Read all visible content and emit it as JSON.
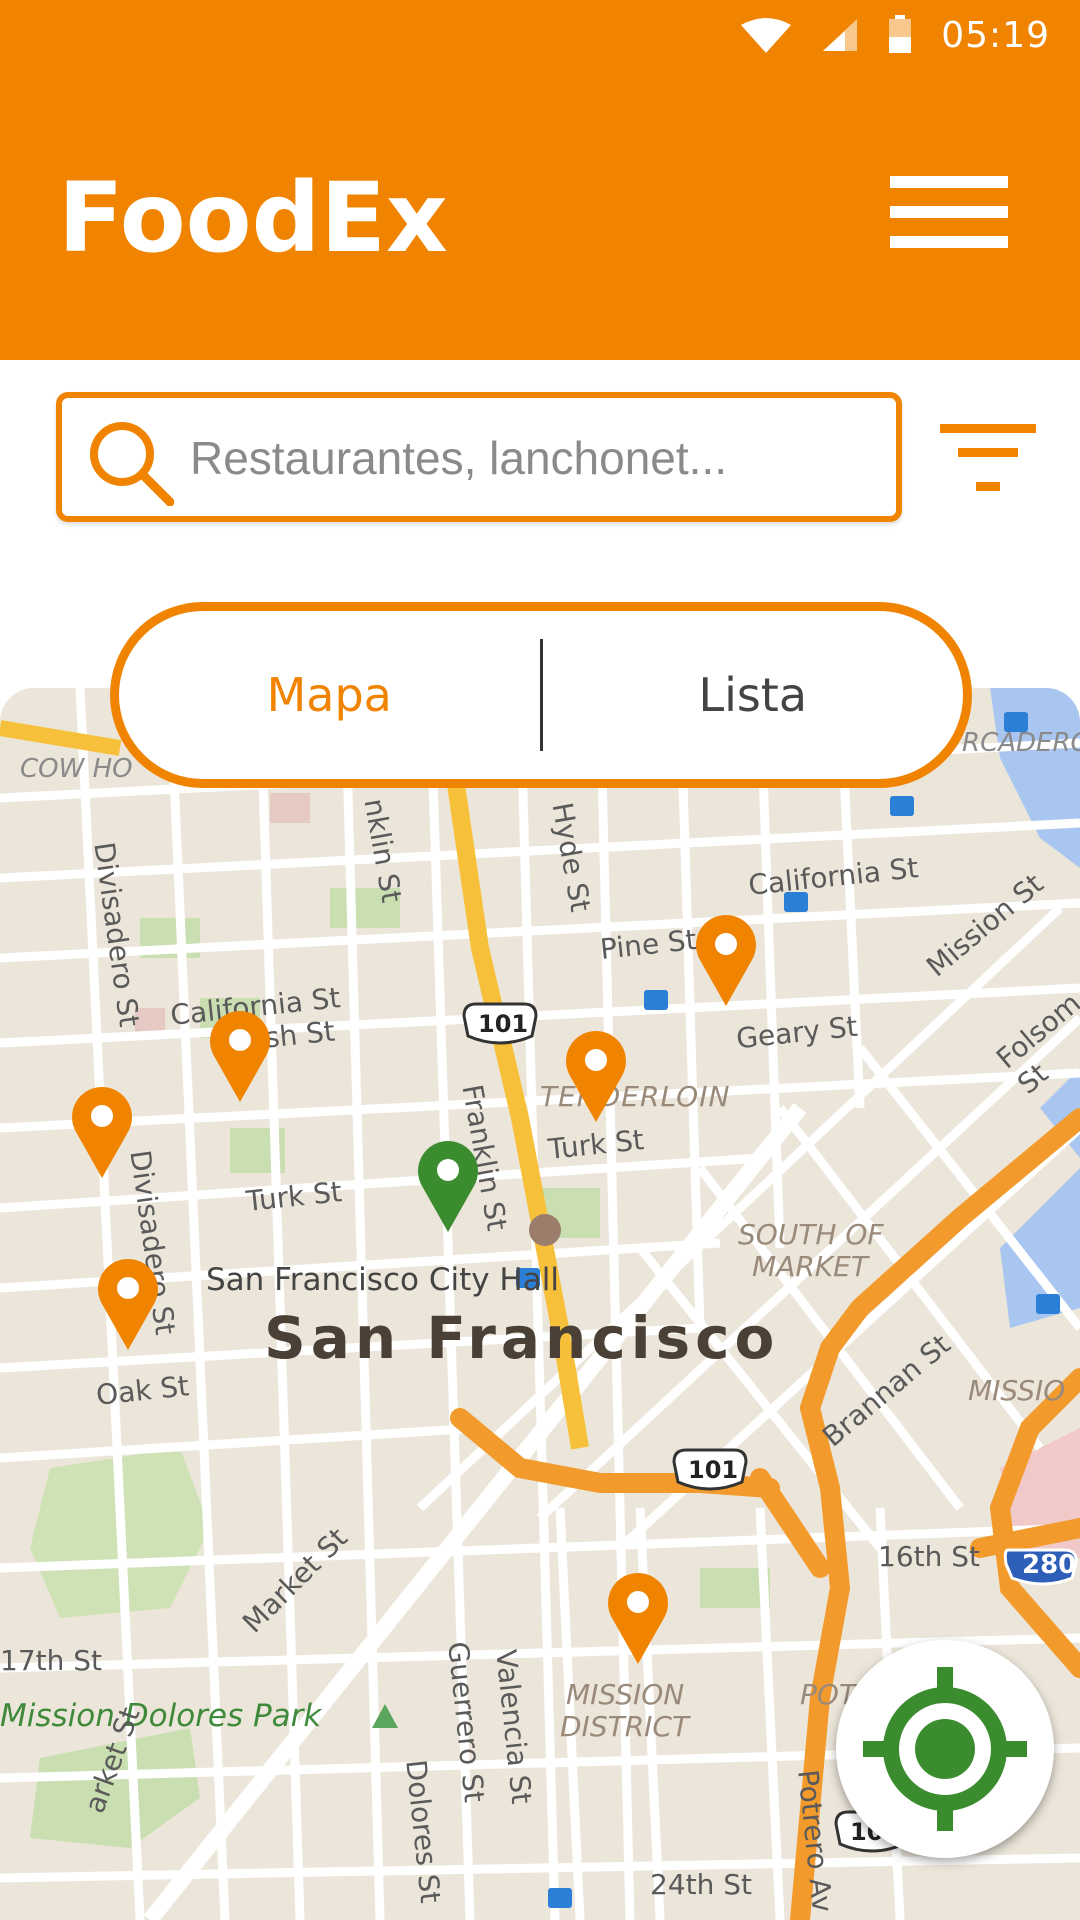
{
  "status_bar": {
    "time": "05:19",
    "icons": [
      "wifi-icon",
      "signal-icon",
      "battery-icon"
    ]
  },
  "header": {
    "title": "FoodEx",
    "menu_icon": "hamburger-menu-icon"
  },
  "search": {
    "placeholder": "Restaurantes, lanchonet...",
    "value": "",
    "icon": "search-icon"
  },
  "filter": {
    "icon": "filter-icon"
  },
  "view_toggle": {
    "options": [
      "Mapa",
      "Lista"
    ],
    "selected": "Mapa"
  },
  "map": {
    "labels": {
      "city": "San Francisco",
      "city_hall": "San Francisco City Hall",
      "tenderloin": "TENDERLOIN",
      "south_of_market_1": "SOUTH OF",
      "south_of_market_2": "MARKET",
      "mission_district_1": "MISSION",
      "mission_district_2": "DISTRICT",
      "mission_dolores_park": "Mission Dolores Park",
      "cow_hollow": "COW HO",
      "embarcadero": "RCADERO",
      "mission_right": "MISSIO",
      "potrero": "POT",
      "california_st_left": "California St",
      "california_st_right": "California St",
      "pine_st": "Pine St",
      "bush_st": "Bush St",
      "geary_st": "Geary St",
      "turk_st_left": "Turk St",
      "turk_st_right": "Turk St",
      "oak_st": "Oak St",
      "market_st": "Market St",
      "brannan_st": "Brannan St",
      "mission_st": "Mission St",
      "folsom_st": "Folsom St",
      "16th_st": "16th St",
      "17th_st": "17th St",
      "24th_st": "24th St",
      "divisadero_st_1": "Divisadero St",
      "divisadero_st_2": "Divisadero St",
      "franklin_st_top": "nklin St",
      "franklin_st": "Franklin St",
      "hyde_st": "Hyde St",
      "guerrero_st": "Guerrero St",
      "valencia_st": "Valencia St",
      "dolores_st": "Dolores St",
      "potrero_av": "Potrero Av",
      "market_left": "arket St",
      "us101_a": "101",
      "us101_b": "101",
      "us101_c": "101",
      "i280": "280"
    },
    "pins": [
      {
        "color": "#f08400",
        "selected": false
      },
      {
        "color": "#f08400",
        "selected": false
      },
      {
        "color": "#f08400",
        "selected": false
      },
      {
        "color": "#f08400",
        "selected": false
      },
      {
        "color": "#f08400",
        "selected": false
      },
      {
        "color": "#3a8c2e",
        "selected": true
      },
      {
        "color": "#f08400",
        "selected": false
      }
    ]
  },
  "locate_button": {
    "icon": "gps-locate-icon",
    "color": "#3a8c2e"
  },
  "colors": {
    "primary": "#f08400",
    "accent_green": "#3a8c2e"
  }
}
